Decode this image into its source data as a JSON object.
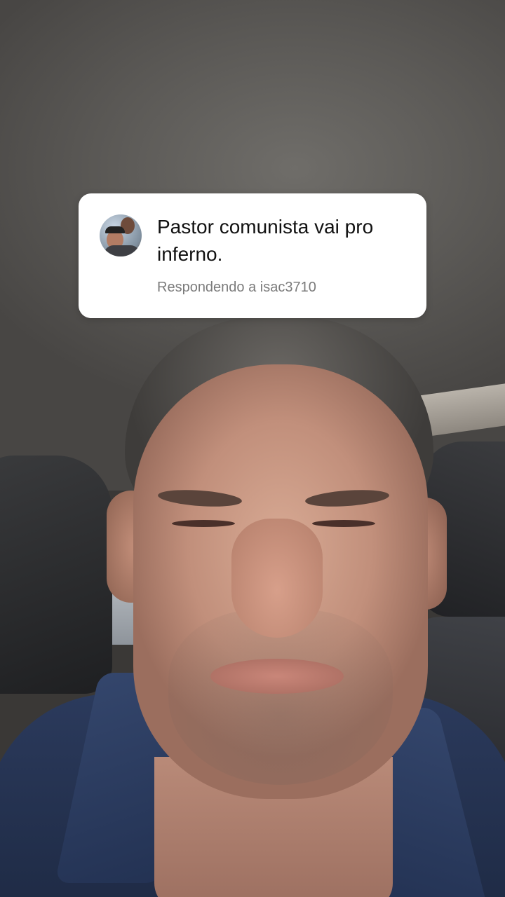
{
  "reply_sticker": {
    "comment_text": "Pastor comunista vai pro inferno.",
    "replying_to": "Respondendo a isac3710",
    "avatar_icon": "user-avatar"
  },
  "colors": {
    "card_background": "#ffffff",
    "comment_text": "#111111",
    "subtext": "#7b7b7b"
  }
}
